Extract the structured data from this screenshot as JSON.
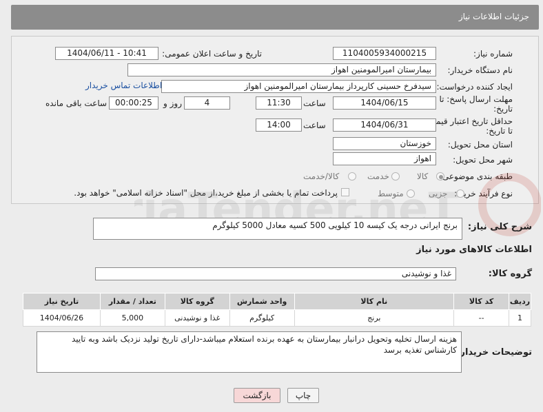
{
  "header": {
    "title": "جزئیات اطلاعات نیاز"
  },
  "form": {
    "need_number": {
      "label": "شماره نیاز:",
      "value": "1104005934000215"
    },
    "announce": {
      "label": "تاریخ و ساعت اعلان عمومی:",
      "value": "1404/06/11 - 10:41"
    },
    "buyer": {
      "label": "نام دستگاه خریدار:",
      "value": "بیمارستان امیرالمومنین اهواز"
    },
    "creator": {
      "label": "ایجاد کننده درخواست:",
      "value": "سیدفرخ حسینی کارپرداز بیمارستان امیرالمومنین اهواز",
      "contact_link": "اطلاعات تماس خریدار"
    },
    "reply_deadline": {
      "label_line1": "مهلت ارسال پاسخ: تا",
      "label_line2": "تاریخ:",
      "date": "1404/06/15",
      "time_label": "ساعت",
      "time": "11:30",
      "days": "4",
      "days_label": "روز و",
      "remaining": "00:00:25",
      "remaining_label": "ساعت باقی مانده"
    },
    "price_validity": {
      "label_line1": "حداقل تاریخ اعتبار قیمت:",
      "label_line2": "تا تاریخ:",
      "date": "1404/06/31",
      "time_label": "ساعت",
      "time": "14:00"
    },
    "province": {
      "label": "استان محل تحویل:",
      "value": "خوزستان"
    },
    "city": {
      "label": "شهر محل تحویل:",
      "value": "اهواز"
    },
    "category": {
      "label": "طبقه بندی موضوعی:",
      "options": [
        "کالا",
        "خدمت",
        "کالا/خدمت"
      ],
      "selected": "کالا"
    },
    "process": {
      "label": "نوع فرآیند خرید :",
      "options": [
        "جزیی",
        "متوسط"
      ],
      "selected": "",
      "payment_note": "پرداخت تمام یا بخشی از مبلغ خرید،از محل \"اسناد خزانه اسلامی\" خواهد بود."
    }
  },
  "summary": {
    "label": "شرح کلی نیاز:",
    "value": "برنج ایرانی درجه یک کیسه 10 کیلویی 500 کسیه معادل 5000 کیلوگرم"
  },
  "goods_section_title": "اطلاعات کالاهای مورد نیاز",
  "goods_group": {
    "label": "گروه کالا:",
    "value": "غذا و نوشیدنی"
  },
  "table": {
    "headers": [
      "ردیف",
      "کد کالا",
      "نام کالا",
      "واحد شمارش",
      "گروه کالا",
      "تعداد / مقدار",
      "تاریخ نیاز"
    ],
    "rows": [
      [
        "1",
        "--",
        "برنج",
        "کیلوگرم",
        "غذا و نوشیدنی",
        "5,000",
        "1404/06/26"
      ]
    ]
  },
  "buyer_notes": {
    "label": "توضیحات خریدار:",
    "value": "هزینه ارسال تخلیه وتحویل درانبار بیمارستان به عهده برنده استعلام میباشد-دارای تاریخ تولید نزدیک باشد وبه تایید کارشناس تغذیه برسد"
  },
  "buttons": {
    "print": "چاپ",
    "back": "بازگشت"
  },
  "watermark": {
    "text": "AriaTender.neT",
    "color": "#c0392b"
  }
}
